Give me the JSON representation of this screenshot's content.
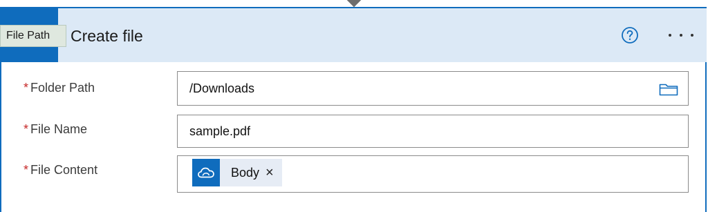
{
  "tooltip": {
    "text": "File Path"
  },
  "card": {
    "title": "Create file",
    "help_icon": "help-icon",
    "more_icon": "more-icon",
    "accent_color": "#0f6cbd",
    "header_color": "#dce9f6"
  },
  "fields": {
    "folder_path": {
      "required": "*",
      "label": "Folder Path",
      "value": "/Downloads",
      "picker_icon": "folder-icon"
    },
    "file_name": {
      "required": "*",
      "label": "File Name",
      "value": "sample.pdf"
    },
    "file_content": {
      "required": "*",
      "label": "File Content",
      "token": {
        "label": "Body",
        "remove": "×",
        "icon": "onedrive-cloud-icon"
      }
    }
  }
}
